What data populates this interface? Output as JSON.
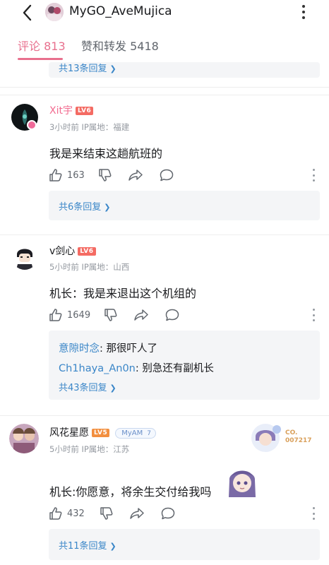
{
  "header": {
    "title": "MyGO_AveMujica",
    "back_icon": "chevron-left-icon",
    "more_icon": "vertical-dots-icon"
  },
  "tabs": [
    {
      "label": "评论 813",
      "active": true
    },
    {
      "label": "赞和转发 5418",
      "active": false
    }
  ],
  "colors": {
    "accent": "#e8708e",
    "link": "#3a86c8",
    "meta": "#9499a0",
    "level_badge": "#f46b63",
    "level_badge_5": "#f28f3f"
  },
  "top_partial": {
    "more_replies": "共13条回复"
  },
  "comments": [
    {
      "username": "Xit宇",
      "level": "LV6",
      "meta": "3小时前 IP属地：福建",
      "text": "我是来结束这趟航班的",
      "likes": "163",
      "replies_label": "共6条回复"
    },
    {
      "username": "v剑心",
      "level": "LV6",
      "meta": "5小时前 IP属地：山西",
      "text": "机长：我是来退出这个机组的",
      "likes": "1649",
      "sub_replies": [
        {
          "user": "意隙时念",
          "text": ": 那很吓人了"
        },
        {
          "user": "Ch1haya_An0n",
          "text": ": 别急还有副机长"
        }
      ],
      "replies_label": "共43条回复"
    },
    {
      "username": "风花星愿",
      "level": "LV5",
      "fan_badge": "MyAM",
      "fan_level": "7",
      "card_code": [
        "CO.",
        "007217"
      ],
      "meta": "5小时前 IP属地：江苏",
      "text": "机长:你愿意，将余生交付给我吗",
      "likes": "432",
      "replies_label": "共11条回复"
    }
  ]
}
